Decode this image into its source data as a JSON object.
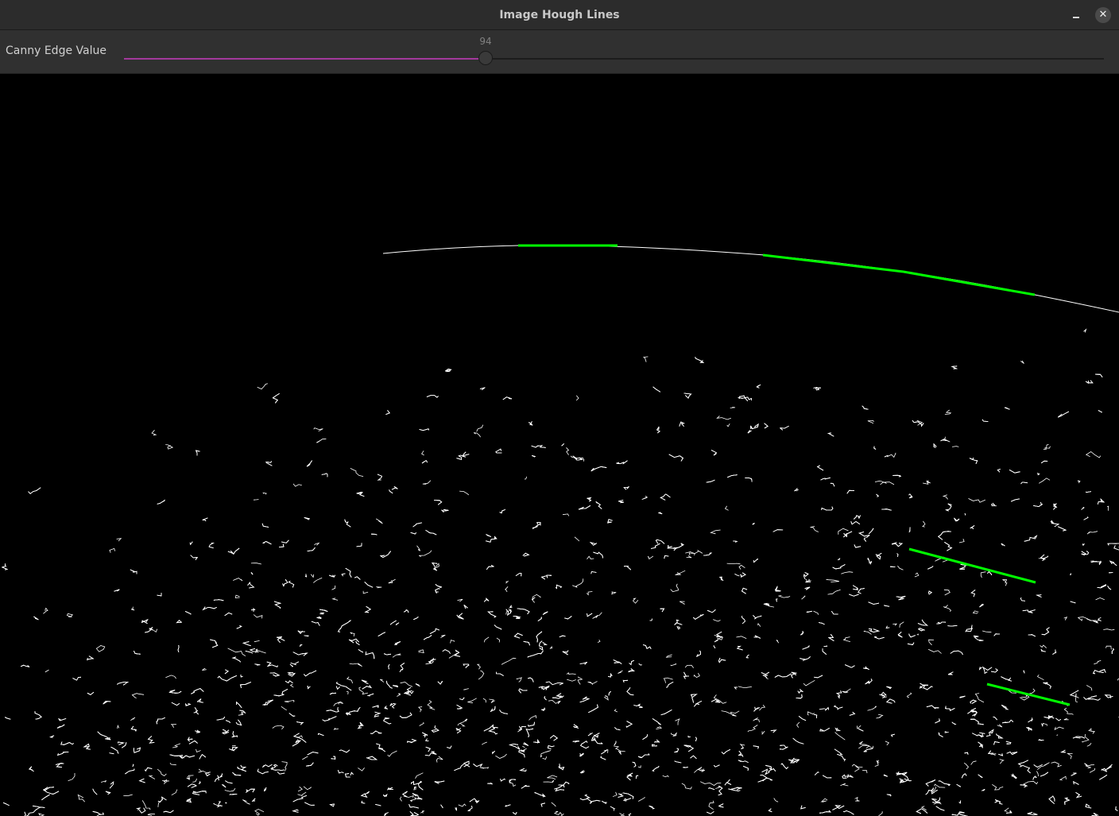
{
  "window": {
    "title": "Image Hough Lines",
    "close_glyph": "✕"
  },
  "trackbar": {
    "label": "Canny Edge Value",
    "value": 94,
    "max": 255,
    "fill_color": "#a3399c"
  },
  "image": {
    "edge_color": "#ffffff",
    "line_color": "#00ff00",
    "detected_line_count": 5
  },
  "icons": {
    "minimize": "minimize-icon",
    "close": "close-icon"
  }
}
